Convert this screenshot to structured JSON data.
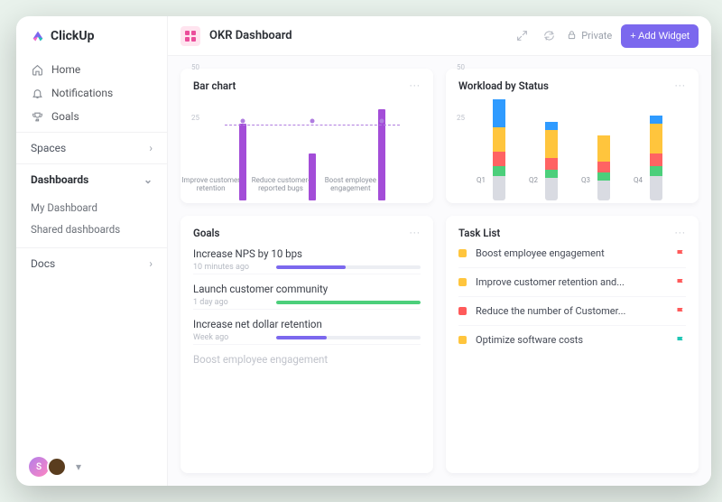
{
  "brand": "ClickUp",
  "nav": [
    "Home",
    "Notifications",
    "Goals"
  ],
  "sections": {
    "spaces": "Spaces",
    "dashboards": "Dashboards",
    "dashboards_items": [
      "My Dashboard",
      "Shared dashboards"
    ],
    "docs": "Docs"
  },
  "header": {
    "title": "OKR Dashboard",
    "private": "Private",
    "add_widget": "+ Add Widget"
  },
  "cards": {
    "bar": {
      "title": "Bar chart"
    },
    "workload": {
      "title": "Workload by Status"
    },
    "goals": {
      "title": "Goals",
      "items": [
        {
          "title": "Increase NPS by 10 bps",
          "time": "10 minutes ago"
        },
        {
          "title": "Launch customer community",
          "time": "1 day ago"
        },
        {
          "title": "Increase net dollar retention",
          "time": "Week ago"
        },
        {
          "title": "Boost employee engagement",
          "time": ""
        }
      ]
    },
    "tasks": {
      "title": "Task List",
      "items": [
        "Boost employee engagement",
        "Improve customer retention and...",
        "Reduce the number of Customer...",
        "Optimize software costs"
      ]
    }
  },
  "chart_data": [
    {
      "type": "bar",
      "title": "Bar chart",
      "categories": [
        "Improve customer retention",
        "Reduce customer-reported bugs",
        "Boost employee engagement"
      ],
      "values": [
        38,
        23,
        45
      ],
      "ylim": [
        0,
        50
      ],
      "yticks": [
        25,
        50
      ],
      "annotation": 37,
      "color": "#a34dd8"
    },
    {
      "type": "bar_stacked",
      "title": "Workload by Status",
      "categories": [
        "Q1",
        "Q2",
        "Q3",
        "Q4"
      ],
      "ylim": [
        0,
        50
      ],
      "yticks": [
        25,
        50
      ],
      "series_colors": [
        "#d9dbe2",
        "#4ccf7b",
        "#ff6363",
        "#ffc53d",
        "#2f9bff"
      ],
      "stacks": [
        [
          12,
          5,
          7,
          12,
          14
        ],
        [
          11,
          4,
          6,
          14,
          4
        ],
        [
          10,
          4,
          5,
          13,
          0
        ],
        [
          12,
          5,
          6,
          15,
          4
        ]
      ]
    }
  ],
  "goals_progress": [
    {
      "pct": 48,
      "color": "#7b68ee"
    },
    {
      "pct": 100,
      "color": "#4ccf7b"
    },
    {
      "pct": 35,
      "color": "#7b68ee"
    },
    {
      "pct": 0,
      "color": "#7b68ee"
    }
  ],
  "task_colors": [
    "#ffc53d",
    "#ffc53d",
    "#ff5a5a",
    "#ffc53d"
  ],
  "flag_colors": [
    "#ff5a5a",
    "#ff5a5a",
    "#ff5a5a",
    "#1fc6b5"
  ]
}
